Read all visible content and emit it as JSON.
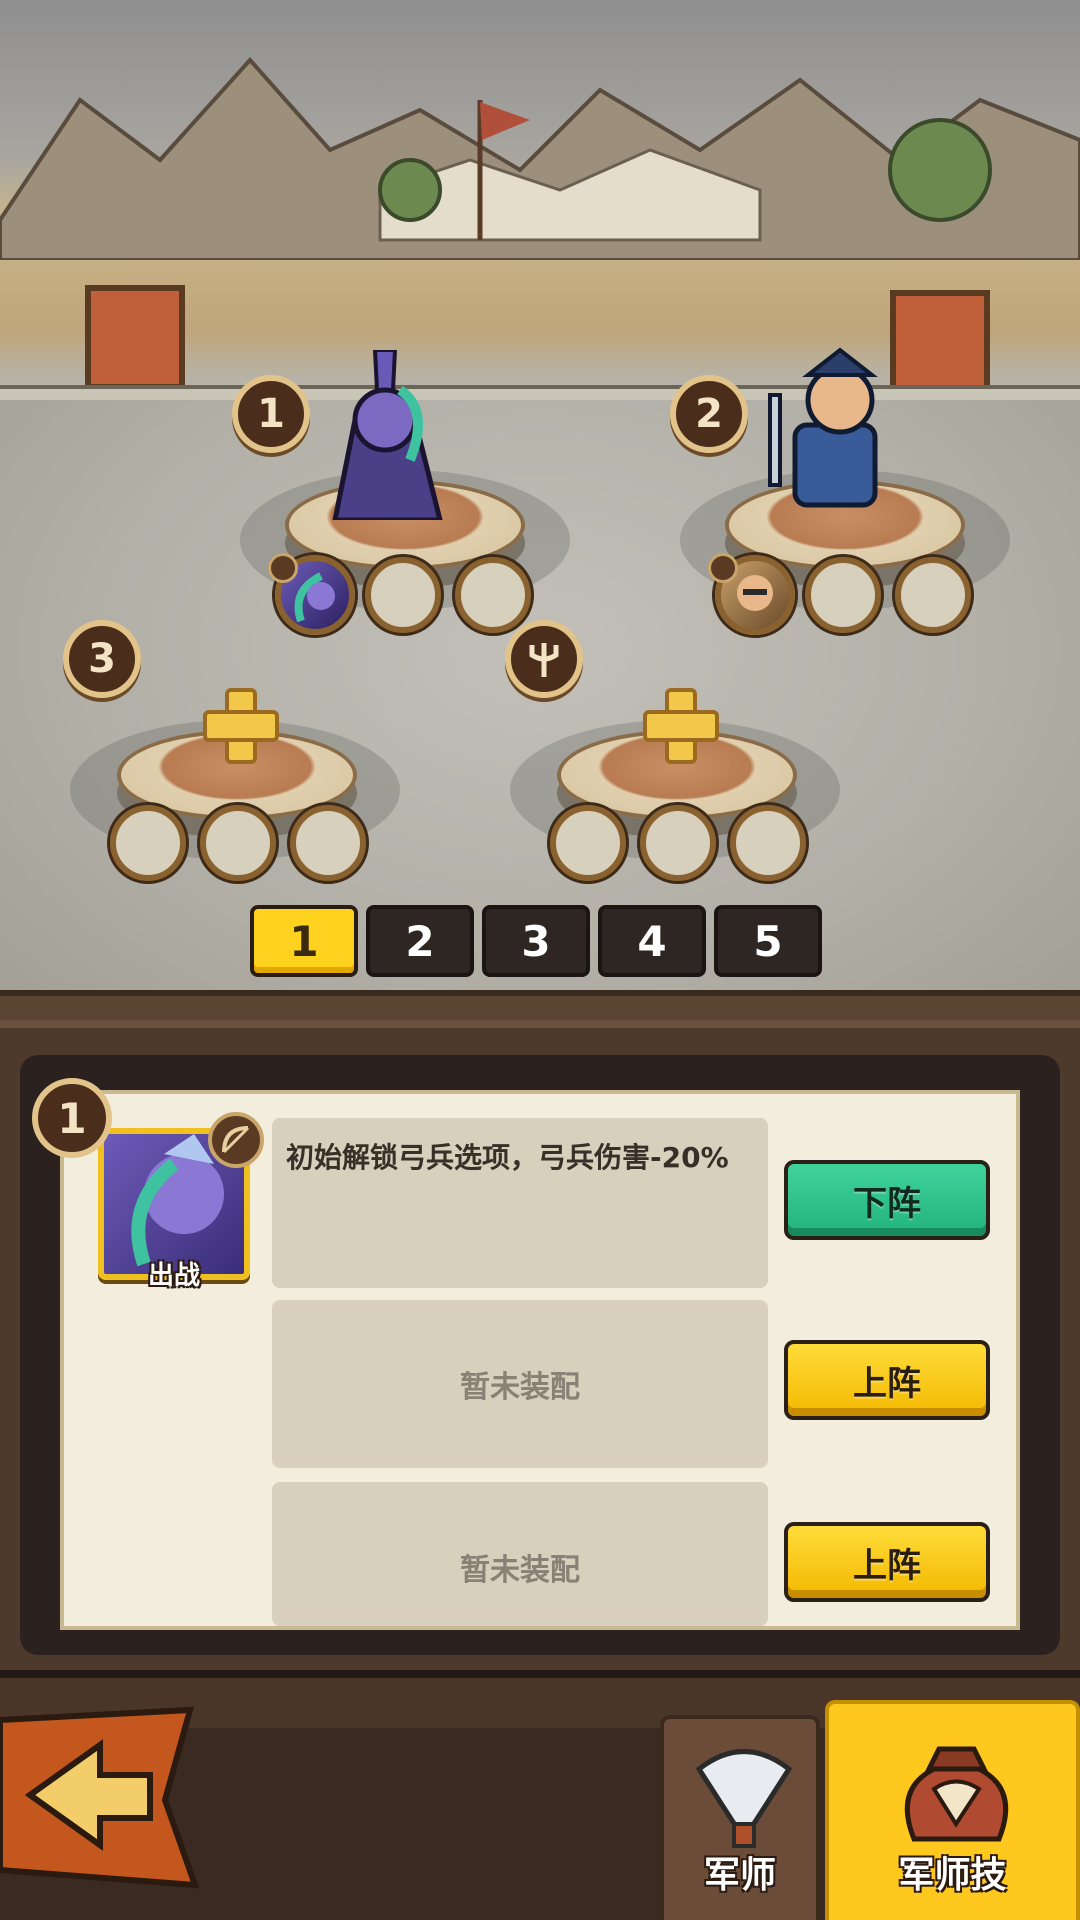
{
  "formation": {
    "slots": [
      {
        "number": "1",
        "hero": "dark-strategist",
        "filled": true
      },
      {
        "number": "2",
        "hero": "blue-swordsman",
        "filled": true
      },
      {
        "number": "3",
        "hero": null,
        "filled": false
      },
      {
        "number": "",
        "hero": null,
        "filled": false,
        "badge": "trident-icon"
      }
    ],
    "page_tabs": [
      "1",
      "2",
      "3",
      "4",
      "5"
    ],
    "active_page": "1"
  },
  "detail": {
    "slot_number": "1",
    "portrait_label": "出战",
    "skills": [
      {
        "text": "初始解锁弓兵选项，弓兵伤害-20%",
        "button": "下阵",
        "button_color": "#23b27c"
      },
      {
        "text": "暂未装配",
        "button": "上阵",
        "button_color": "#f3b800"
      },
      {
        "text": "暂未装配",
        "button": "上阵",
        "button_color": "#f3b800"
      }
    ]
  },
  "bottom_nav": {
    "back_icon": "back-arrow-icon",
    "tabs": [
      {
        "label": "军师",
        "icon": "feather-fan-icon",
        "active": false
      },
      {
        "label": "军师技",
        "icon": "pouch-icon",
        "active": true
      }
    ]
  },
  "colors": {
    "active_tab": "#ffd21f",
    "green_button": "#23b27c",
    "yellow_button": "#f3b800"
  }
}
